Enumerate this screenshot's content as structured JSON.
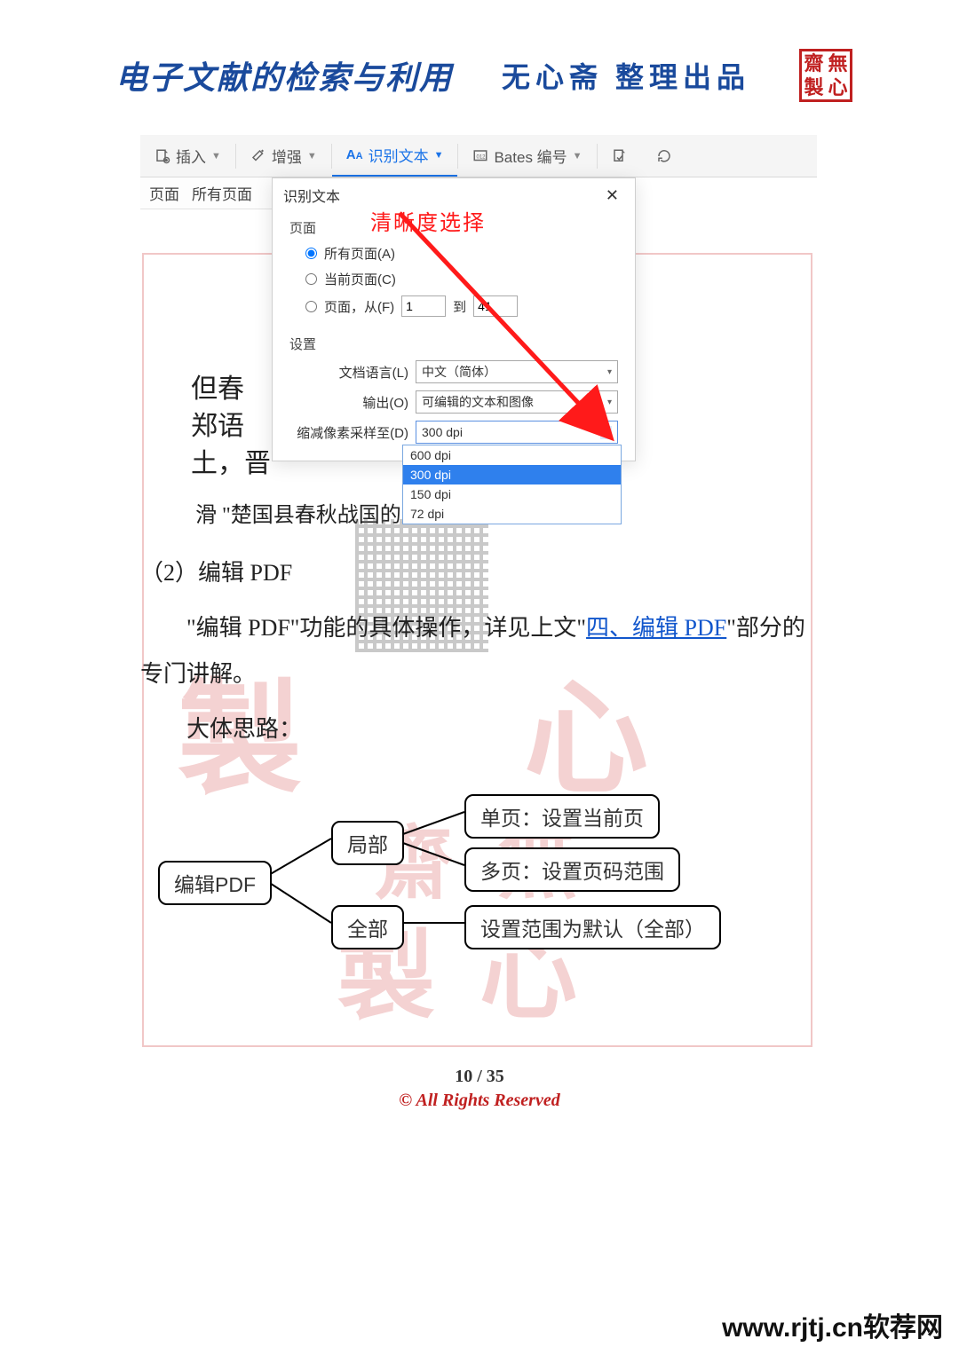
{
  "header": {
    "title": "电子文献的检索与利用",
    "subtitle": "无心斋  整理出品",
    "seal": [
      "齋",
      "無",
      "製",
      "心"
    ]
  },
  "toolbar": {
    "insert": "插入",
    "enhance": "增强",
    "ocr": "识别文本",
    "bates": "Bates 编号"
  },
  "secbar": {
    "left": "页面",
    "all": "所有页面"
  },
  "dialog": {
    "title": "识别文本",
    "annotation": "清晰度选择",
    "group_page": "页面",
    "radio_all": "所有页面(A)",
    "radio_current": "当前页面(C)",
    "radio_range": "页面，从(F)",
    "range_from": "1",
    "range_mid": "到",
    "range_to": "41",
    "group_settings": "设置",
    "label_lang": "文档语言(L)",
    "value_lang": "中文（简体）",
    "label_output": "输出(O)",
    "value_output": "可编辑的文本和图像",
    "label_dpi": "缩减像素采样至(D)",
    "value_dpi": "300 dpi",
    "options": [
      "600 dpi",
      "300 dpi",
      "150 dpi",
      "72 dpi"
    ],
    "selected_option": "300 dpi"
  },
  "bg_text": {
    "l1": "但春",
    "l2": "郑语",
    "l3": "土，晋",
    "l4p": "滑 \"楚国县春秋战国的道理十部事要语保"
  },
  "article": {
    "sec_title": "（2）编辑 PDF",
    "p1_pre": "\"编辑 PDF\"功能的具体操作，详见上文\"",
    "p1_link": "四、编辑 PDF",
    "p1_post": "\"部分的专门讲解。",
    "p2": "大体思路："
  },
  "diagram": {
    "root": "编辑PDF",
    "b1": "局部",
    "b2": "全部",
    "leaf1": "单页：设置当前页",
    "leaf2": "多页：设置页码范围",
    "leaf3": "设置范围为默认（全部）"
  },
  "footer": {
    "page": "10  /  35",
    "rights": "© All Rights Reserved"
  },
  "site": "www.rjtj.cn软荐网",
  "watermark": {
    "a": "齋",
    "b": "無",
    "c": "製",
    "d": "心"
  }
}
